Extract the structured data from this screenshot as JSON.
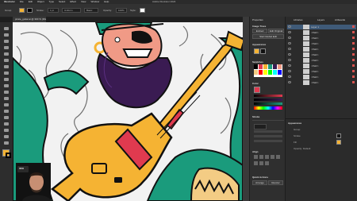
{
  "menubar": {
    "app_name": "Illustrator",
    "items": [
      "File",
      "Edit",
      "Object",
      "Type",
      "Select",
      "Effect",
      "View",
      "Window",
      "Help"
    ]
  },
  "window": {
    "title": "Adobe Illustrator 2024"
  },
  "document_tab": {
    "label": "pirate_guitar.ai @ 300 % (RGB/Preview)"
  },
  "control_bar": {
    "selection_label": "Group",
    "stroke_label": "Stroke:",
    "stroke_value": "1 pt",
    "uniform_label": "Uniform",
    "basic_label": "Basic",
    "opacity_label": "Opacity:",
    "opacity_value": "100%",
    "style_label": "Style:"
  },
  "properties_panel": {
    "tabs": [
      "Properties",
      "Libraries",
      "Layers"
    ],
    "section_image_trace": "Image Trace",
    "btn_embed": "Embed",
    "btn_edit_original": "Edit Original",
    "section_appearance": "Appearance",
    "section_swatches": "Swatches",
    "section_color": "Color",
    "section_stroke": "Stroke",
    "section_align": "Align",
    "section_quick_actions": "Quick Actions",
    "btn_arrange": "Arrange",
    "btn_recolor": "Recolor",
    "btn_start_global_edit": "Start Global Edit"
  },
  "layers_panel": {
    "tabs": [
      "Layers",
      "Artboards"
    ],
    "rows": [
      {
        "name": "Layer 1"
      },
      {
        "name": "<Path>"
      },
      {
        "name": "<Path>"
      },
      {
        "name": "<Path>"
      },
      {
        "name": "<Path>"
      },
      {
        "name": "<Path>"
      },
      {
        "name": "<Path>"
      },
      {
        "name": "<Path>"
      },
      {
        "name": "<Path>"
      },
      {
        "name": "<Path>"
      },
      {
        "name": "<Path>"
      }
    ],
    "appearance_title": "Appearance",
    "appearance_rows": [
      "Group",
      "Stroke",
      "Fill",
      "Opacity: Default"
    ]
  },
  "webcam": {
    "logo": "VFX"
  },
  "colors": {
    "teal": "#1a9b7c",
    "beard": "#3a1b52",
    "guitar_yellow": "#f5b333",
    "guitar_red": "#e03a4f",
    "sand": "#f3cc84",
    "skin": "#f09a86",
    "panel_bg": "#2f2f2f",
    "selection_blue": "#3f5a78"
  },
  "swatches": [
    "#ffffff",
    "#000000",
    "#e03a4f",
    "#f5b333",
    "#1a9b7c",
    "#3a1b52",
    "#f09a86",
    "#f3cc84",
    "#ff0000",
    "#ffff00",
    "#00ff00",
    "#00ffff",
    "#0000ff",
    "#ff00ff",
    "#999999",
    "#f7931e"
  ]
}
